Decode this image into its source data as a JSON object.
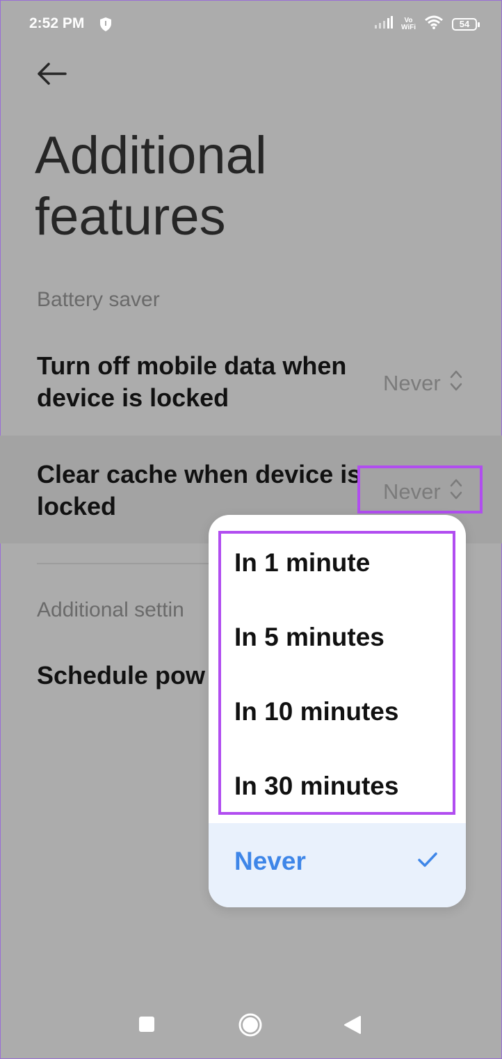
{
  "status_bar": {
    "time": "2:52 PM",
    "vowifi_top": "Vo",
    "vowifi_bottom": "WiFi",
    "battery": "54",
    "icons": [
      "shield-icon",
      "signal-icon",
      "vowifi-icon",
      "wifi-icon",
      "battery-icon"
    ]
  },
  "header": {
    "back_icon": "arrow-left-icon"
  },
  "page": {
    "title": "Additional features"
  },
  "sections": {
    "battery_saver": "Battery saver",
    "additional_settings": "Additional settin"
  },
  "rows": {
    "mobile_data": {
      "title": "Turn off mobile data when device is locked",
      "value": "Never"
    },
    "clear_cache": {
      "title": "Clear cache when device is locked",
      "value": "Never"
    },
    "schedule_power": {
      "title": "Schedule pow"
    }
  },
  "dropdown": {
    "options": [
      "In 1 minute",
      "In 5 minutes",
      "In 10 minutes",
      "In 30 minutes"
    ],
    "selected": "Never",
    "selected_icon": "check-icon"
  },
  "nav_bar": {
    "icons": [
      "recents-square-icon",
      "home-circle-icon",
      "back-triangle-icon"
    ]
  },
  "colors": {
    "highlight": "#b14df0",
    "selected_text": "#3e86e8",
    "selected_bg": "#e9f1fc",
    "background": "#acacac"
  }
}
